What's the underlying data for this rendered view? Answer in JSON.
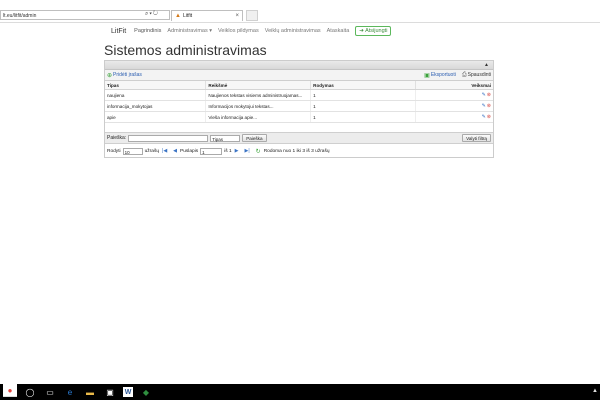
{
  "browser": {
    "address": "lt.eu/litfit/admin",
    "tab_title": "Litfit",
    "tab_close": "×"
  },
  "navbar": {
    "brand": "LitFit",
    "items": [
      "Pagrindinis",
      "Administravimas ▾",
      "Veiklos pildymas",
      "Veiklų administravimas",
      "Ataskaita"
    ],
    "logout": "Atsijungti"
  },
  "page": {
    "title": "Sistemos administravimas"
  },
  "toolbar": {
    "add": "Pridėti įrašas",
    "export": "Eksportuoti",
    "print": "Spausdinti"
  },
  "table": {
    "headers": [
      "Tipas",
      "Reikšmė",
      "Rodymas",
      "Veiksmai"
    ],
    "rows": [
      [
        "naujiena",
        "Naujienos tekstas visiems administruojamas...",
        "1"
      ],
      [
        "informacija_mokytojas",
        "Informacijos mokytojui tekstas...",
        "1"
      ],
      [
        "apie",
        "Viešа informacija apie...",
        "1"
      ]
    ]
  },
  "filter": {
    "label": "Paieška:",
    "field_select": "Tipas",
    "search_button": "Paieška",
    "clear_button": "Valyti filtrą"
  },
  "pager": {
    "show_label": "Rodyti",
    "page_size": "10",
    "per_page_label": "užrašų",
    "page_label": "Puslapis",
    "page_value": "1",
    "of_label": "iš 1",
    "summary": "Rodoma nuo 1 iki 3 iš 3 užrašų"
  },
  "colors": {
    "accent": "#5cb85c",
    "link": "#2a5db0",
    "delete": "#d9534f"
  }
}
